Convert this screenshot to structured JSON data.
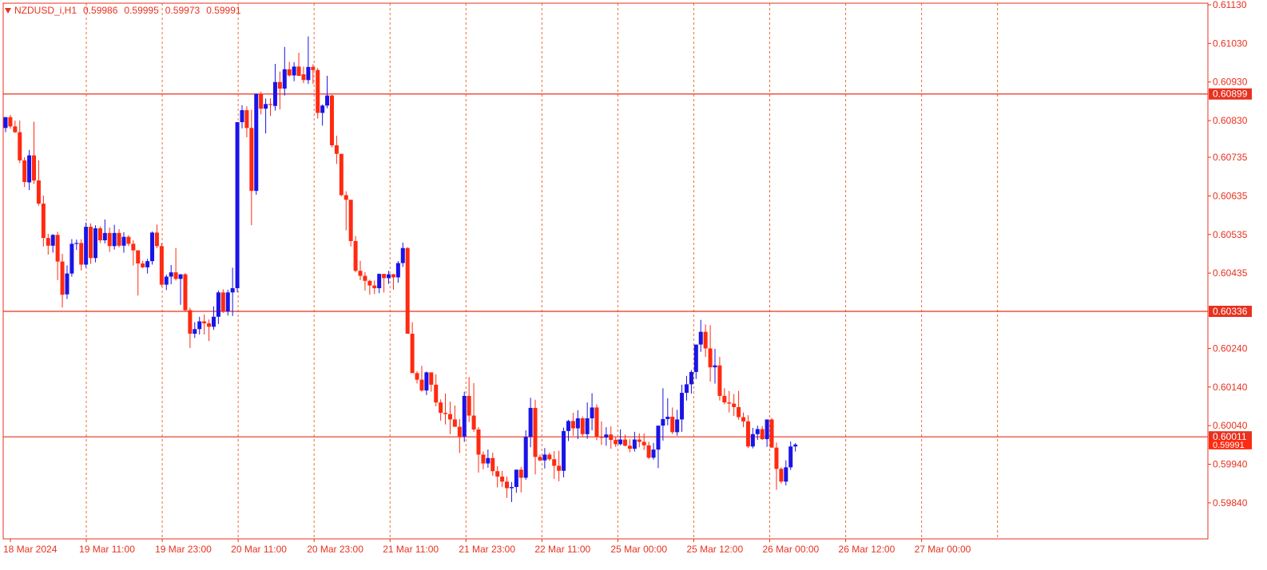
{
  "header": {
    "symbol": "NZDUSD_i,H1",
    "open": "0.59986",
    "high": "0.59995",
    "low": "0.59973",
    "close": "0.59991"
  },
  "colors": {
    "bull": "#1a14e6",
    "bear": "#ff2a10",
    "axis": "#e8311f",
    "grid": "#f26b3a",
    "level": "#e8311f"
  },
  "chart_data": {
    "type": "candlestick",
    "timeframe": "H1",
    "ylim": [
      0.59786,
      0.6113
    ],
    "y_ticks": [
      "0.61130",
      "0.61030",
      "0.60930",
      "0.60830",
      "0.60735",
      "0.60635",
      "0.60535",
      "0.60435",
      "0.60240",
      "0.60140",
      "0.60040",
      "0.59940",
      "0.59840"
    ],
    "x_ticks": [
      "18 Mar 2024",
      "19 Mar 11:00",
      "19 Mar 23:00",
      "20 Mar 11:00",
      "20 Mar 23:00",
      "21 Mar 11:00",
      "21 Mar 23:00",
      "22 Mar 11:00",
      "25 Mar 00:00",
      "25 Mar 12:00",
      "26 Mar 00:00",
      "26 Mar 12:00",
      "27 Mar 00:00"
    ],
    "grid": "vertical-dashed",
    "levels": [
      {
        "label": "0.60899",
        "value": 0.60899
      },
      {
        "label": "0.60336",
        "value": 0.60336
      },
      {
        "label": "0.60011",
        "value": 0.60011
      }
    ],
    "current_price": {
      "label": "0.59991",
      "value": 0.59991
    },
    "candles": [
      [
        0.60811,
        0.60839,
        0.608,
        0.60839
      ],
      [
        0.60839,
        0.60845,
        0.60809,
        0.60815
      ],
      [
        0.60815,
        0.6083,
        0.60798,
        0.608
      ],
      [
        0.608,
        0.6083,
        0.6072,
        0.60727
      ],
      [
        0.60727,
        0.60735,
        0.60658,
        0.60671
      ],
      [
        0.6067,
        0.60754,
        0.6065,
        0.6074
      ],
      [
        0.6074,
        0.60827,
        0.60666,
        0.60675
      ],
      [
        0.60675,
        0.60727,
        0.6061,
        0.60615
      ],
      [
        0.60615,
        0.60636,
        0.60504,
        0.60526
      ],
      [
        0.60526,
        0.60537,
        0.60483,
        0.60506
      ],
      [
        0.60506,
        0.60536,
        0.60488,
        0.60534
      ],
      [
        0.60534,
        0.60542,
        0.60417,
        0.60465
      ],
      [
        0.60465,
        0.60485,
        0.60346,
        0.60379
      ],
      [
        0.6038,
        0.60455,
        0.60368,
        0.60434
      ],
      [
        0.60434,
        0.60523,
        0.60426,
        0.60511
      ],
      [
        0.60511,
        0.60522,
        0.60495,
        0.60513
      ],
      [
        0.60513,
        0.60523,
        0.60442,
        0.60457
      ],
      [
        0.60457,
        0.60566,
        0.60449,
        0.60555
      ],
      [
        0.60555,
        0.60564,
        0.60459,
        0.60474
      ],
      [
        0.60474,
        0.60559,
        0.60463,
        0.60551
      ],
      [
        0.60551,
        0.60556,
        0.60513,
        0.6052
      ],
      [
        0.6052,
        0.60574,
        0.60512,
        0.60539
      ],
      [
        0.60539,
        0.60553,
        0.6049,
        0.60505
      ],
      [
        0.60505,
        0.6056,
        0.60496,
        0.60539
      ],
      [
        0.60539,
        0.60549,
        0.60502,
        0.60506
      ],
      [
        0.60506,
        0.60541,
        0.60488,
        0.60529
      ],
      [
        0.60529,
        0.60533,
        0.60505,
        0.60511
      ],
      [
        0.60511,
        0.6052,
        0.60455,
        0.60494
      ],
      [
        0.60494,
        0.60494,
        0.60377,
        0.6046
      ],
      [
        0.6046,
        0.60467,
        0.60448,
        0.6045
      ],
      [
        0.6045,
        0.60472,
        0.60434,
        0.60466
      ],
      [
        0.60466,
        0.60543,
        0.60457,
        0.6054
      ],
      [
        0.6054,
        0.60561,
        0.605,
        0.60505
      ],
      [
        0.60505,
        0.60513,
        0.604,
        0.60405
      ],
      [
        0.60405,
        0.60431,
        0.60391,
        0.60426
      ],
      [
        0.60426,
        0.60456,
        0.60406,
        0.60437
      ],
      [
        0.60437,
        0.605,
        0.60416,
        0.6042
      ],
      [
        0.6042,
        0.60431,
        0.60353,
        0.60432
      ],
      [
        0.60432,
        0.60435,
        0.60336,
        0.60339
      ],
      [
        0.60339,
        0.60345,
        0.60241,
        0.60278
      ],
      [
        0.60278,
        0.60308,
        0.60267,
        0.6029
      ],
      [
        0.6029,
        0.60322,
        0.60276,
        0.6031
      ],
      [
        0.6031,
        0.60328,
        0.60276,
        0.60305
      ],
      [
        0.60305,
        0.60315,
        0.60259,
        0.60296
      ],
      [
        0.60296,
        0.60349,
        0.60288,
        0.60322
      ],
      [
        0.60322,
        0.6039,
        0.60303,
        0.60385
      ],
      [
        0.60385,
        0.60393,
        0.60332,
        0.60336
      ],
      [
        0.60336,
        0.60392,
        0.60325,
        0.60385
      ],
      [
        0.60385,
        0.60449,
        0.60324,
        0.60396
      ],
      [
        0.60396,
        0.60826,
        0.60386,
        0.60826
      ],
      [
        0.60826,
        0.6087,
        0.6081,
        0.60857
      ],
      [
        0.60857,
        0.60867,
        0.60787,
        0.60811
      ],
      [
        0.60811,
        0.60858,
        0.60559,
        0.60648
      ],
      [
        0.60648,
        0.609,
        0.60638,
        0.60899
      ],
      [
        0.60899,
        0.60905,
        0.60846,
        0.60861
      ],
      [
        0.60861,
        0.60887,
        0.60797,
        0.60873
      ],
      [
        0.60873,
        0.60888,
        0.60842,
        0.60872
      ],
      [
        0.60868,
        0.60977,
        0.60856,
        0.6093
      ],
      [
        0.6093,
        0.60957,
        0.60859,
        0.60913
      ],
      [
        0.60913,
        0.61021,
        0.60895,
        0.60963
      ],
      [
        0.60963,
        0.60982,
        0.60944,
        0.60947
      ],
      [
        0.60947,
        0.60981,
        0.60932,
        0.6097
      ],
      [
        0.6097,
        0.61006,
        0.60957,
        0.60946
      ],
      [
        0.6095,
        0.6097,
        0.60927,
        0.60935
      ],
      [
        0.60935,
        0.61048,
        0.60925,
        0.60969
      ],
      [
        0.60969,
        0.60976,
        0.60925,
        0.60961
      ],
      [
        0.60961,
        0.60966,
        0.60835,
        0.6085
      ],
      [
        0.6085,
        0.60872,
        0.60817,
        0.60869
      ],
      [
        0.60869,
        0.60946,
        0.60862,
        0.60895
      ],
      [
        0.60895,
        0.60897,
        0.60761,
        0.60766
      ],
      [
        0.60766,
        0.60791,
        0.60718,
        0.60744
      ],
      [
        0.60744,
        0.60743,
        0.60634,
        0.60637
      ],
      [
        0.60637,
        0.60647,
        0.60546,
        0.60625
      ],
      [
        0.60625,
        0.60625,
        0.60504,
        0.60518
      ],
      [
        0.60518,
        0.60531,
        0.60437,
        0.60441
      ],
      [
        0.60441,
        0.60467,
        0.60417,
        0.60428
      ],
      [
        0.60428,
        0.60438,
        0.6039,
        0.60415
      ],
      [
        0.60415,
        0.60418,
        0.60379,
        0.60403
      ],
      [
        0.60403,
        0.60416,
        0.60381,
        0.60396
      ],
      [
        0.60396,
        0.60434,
        0.60383,
        0.60433
      ],
      [
        0.60433,
        0.60431,
        0.60385,
        0.60422
      ],
      [
        0.60422,
        0.60441,
        0.60407,
        0.60432
      ],
      [
        0.60432,
        0.60433,
        0.60392,
        0.60424
      ],
      [
        0.60424,
        0.60466,
        0.6041,
        0.60461
      ],
      [
        0.60461,
        0.60514,
        0.60451,
        0.605
      ],
      [
        0.605,
        0.60502,
        0.60281,
        0.60278
      ],
      [
        0.60278,
        0.60308,
        0.60191,
        0.60176
      ],
      [
        0.60176,
        0.60181,
        0.60149,
        0.60159
      ],
      [
        0.60159,
        0.60195,
        0.60128,
        0.60131
      ],
      [
        0.60131,
        0.6018,
        0.60119,
        0.60178
      ],
      [
        0.60178,
        0.60176,
        0.60128,
        0.60146
      ],
      [
        0.60146,
        0.60173,
        0.6009,
        0.601
      ],
      [
        0.601,
        0.60108,
        0.60053,
        0.60073
      ],
      [
        0.60073,
        0.60123,
        0.60043,
        0.6007
      ],
      [
        0.6007,
        0.60102,
        0.60018,
        0.60056
      ],
      [
        0.60056,
        0.60092,
        0.60037,
        0.60037
      ],
      [
        0.60037,
        0.60057,
        0.59969,
        0.60012
      ],
      [
        0.60012,
        0.60128,
        0.59998,
        0.60117
      ],
      [
        0.60117,
        0.60166,
        0.60049,
        0.60066
      ],
      [
        0.60066,
        0.6015,
        0.60024,
        0.6003
      ],
      [
        0.6003,
        0.60036,
        0.59918,
        0.59965
      ],
      [
        0.59965,
        0.59973,
        0.59927,
        0.59942
      ],
      [
        0.59942,
        0.59978,
        0.59931,
        0.59956
      ],
      [
        0.59956,
        0.5997,
        0.5991,
        0.59922
      ],
      [
        0.59922,
        0.59935,
        0.5988,
        0.59908
      ],
      [
        0.59908,
        0.59923,
        0.59881,
        0.59895
      ],
      [
        0.59895,
        0.59908,
        0.59853,
        0.59878
      ],
      [
        0.59878,
        0.59894,
        0.59842,
        0.59881
      ],
      [
        0.59881,
        0.59921,
        0.59866,
        0.59926
      ],
      [
        0.59926,
        0.59933,
        0.59867,
        0.59905
      ],
      [
        0.59905,
        0.60028,
        0.599,
        0.60011
      ],
      [
        0.60011,
        0.60112,
        0.59984,
        0.60086
      ],
      [
        0.60086,
        0.60107,
        0.59914,
        0.59959
      ],
      [
        0.59959,
        0.59965,
        0.59948,
        0.5995
      ],
      [
        0.5995,
        0.59982,
        0.59929,
        0.59965
      ],
      [
        0.59965,
        0.5997,
        0.59949,
        0.59953
      ],
      [
        0.59953,
        0.59974,
        0.59902,
        0.59936
      ],
      [
        0.59936,
        0.59975,
        0.59896,
        0.59923
      ],
      [
        0.59923,
        0.60035,
        0.59906,
        0.60026
      ],
      [
        0.60026,
        0.60055,
        0.6,
        0.60052
      ],
      [
        0.60052,
        0.60073,
        0.60014,
        0.60033
      ],
      [
        0.60033,
        0.6008,
        0.60005,
        0.60059
      ],
      [
        0.60059,
        0.60064,
        0.60011,
        0.60018
      ],
      [
        0.60018,
        0.601,
        0.60006,
        0.60059
      ],
      [
        0.60059,
        0.60124,
        0.60028,
        0.60087
      ],
      [
        0.60087,
        0.60095,
        0.60002,
        0.60011
      ],
      [
        0.60011,
        0.60051,
        0.5999,
        0.60009
      ],
      [
        0.60009,
        0.60036,
        0.59988,
        0.60017
      ],
      [
        0.60017,
        0.60038,
        0.5998,
        0.60003
      ],
      [
        0.60003,
        0.6001,
        0.59985,
        0.59992
      ],
      [
        0.59992,
        0.6003,
        0.59989,
        0.60004
      ],
      [
        0.60004,
        0.60017,
        0.59986,
        0.59988
      ],
      [
        0.59988,
        0.60005,
        0.59971,
        0.5998
      ],
      [
        0.5998,
        0.60024,
        0.59973,
        0.60004
      ],
      [
        0.60004,
        0.6002,
        0.59984,
        0.59998
      ],
      [
        0.59998,
        0.6002,
        0.59977,
        0.59989
      ],
      [
        0.59989,
        0.59998,
        0.59953,
        0.59957
      ],
      [
        0.59957,
        0.59995,
        0.59952,
        0.59978
      ],
      [
        0.59978,
        0.60024,
        0.5993,
        0.6004
      ],
      [
        0.6004,
        0.60137,
        0.60001,
        0.60057
      ],
      [
        0.60057,
        0.60111,
        0.60041,
        0.60063
      ],
      [
        0.60063,
        0.60087,
        0.60018,
        0.60023
      ],
      [
        0.60023,
        0.60081,
        0.60014,
        0.60056
      ],
      [
        0.60056,
        0.60146,
        0.60024,
        0.60125
      ],
      [
        0.60125,
        0.60169,
        0.60105,
        0.60147
      ],
      [
        0.60147,
        0.60184,
        0.60123,
        0.60179
      ],
      [
        0.60179,
        0.60248,
        0.60161,
        0.6025
      ],
      [
        0.6025,
        0.60314,
        0.60231,
        0.60283
      ],
      [
        0.60283,
        0.60302,
        0.60218,
        0.6024
      ],
      [
        0.6024,
        0.603,
        0.60154,
        0.60191
      ],
      [
        0.60191,
        0.60239,
        0.60149,
        0.60196
      ],
      [
        0.60196,
        0.60218,
        0.60105,
        0.60117
      ],
      [
        0.60117,
        0.60137,
        0.60095,
        0.601
      ],
      [
        0.601,
        0.6013,
        0.60074,
        0.60097
      ],
      [
        0.60097,
        0.60122,
        0.60065,
        0.60088
      ],
      [
        0.60088,
        0.6013,
        0.60055,
        0.60062
      ],
      [
        0.60062,
        0.60074,
        0.60036,
        0.60051
      ],
      [
        0.60051,
        0.60067,
        0.59982,
        0.59986
      ],
      [
        0.59986,
        0.60034,
        0.59981,
        0.60018
      ],
      [
        0.60018,
        0.6004,
        0.60003,
        0.60031
      ],
      [
        0.60031,
        0.60039,
        0.60003,
        0.60005
      ],
      [
        0.60005,
        0.60052,
        0.59985,
        0.60056
      ],
      [
        0.60056,
        0.6006,
        0.59987,
        0.59983
      ],
      [
        0.59983,
        0.59996,
        0.59874,
        0.59928
      ],
      [
        0.59928,
        0.59932,
        0.5989,
        0.59895
      ],
      [
        0.59895,
        0.5995,
        0.59885,
        0.59932
      ],
      [
        0.59932,
        0.59999,
        0.59925,
        0.59986
      ],
      [
        0.59986,
        0.59995,
        0.59973,
        0.59991
      ]
    ]
  }
}
